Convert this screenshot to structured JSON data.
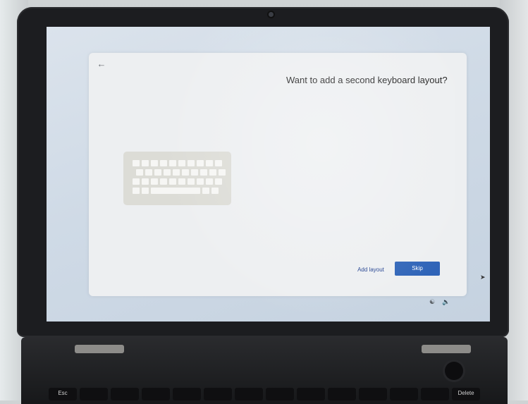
{
  "dialog": {
    "title": "Want to add a second keyboard layout?",
    "back_icon": "back-arrow-icon",
    "illustration": "keyboard-illustration",
    "add_layout_label": "Add layout",
    "skip_label": "Skip"
  },
  "taskbar": {
    "icons": [
      "accessibility-icon",
      "volume-icon"
    ]
  },
  "keyboard": {
    "keys": [
      "Esc",
      "",
      "",
      "",
      "",
      "",
      "",
      "",
      "",
      "",
      "",
      "",
      "",
      "",
      "",
      "Delete"
    ]
  },
  "colors": {
    "accent": "#2f64b8",
    "link": "#1f3f8f",
    "card": "#edeff1",
    "screen": "#d6dfe9"
  }
}
